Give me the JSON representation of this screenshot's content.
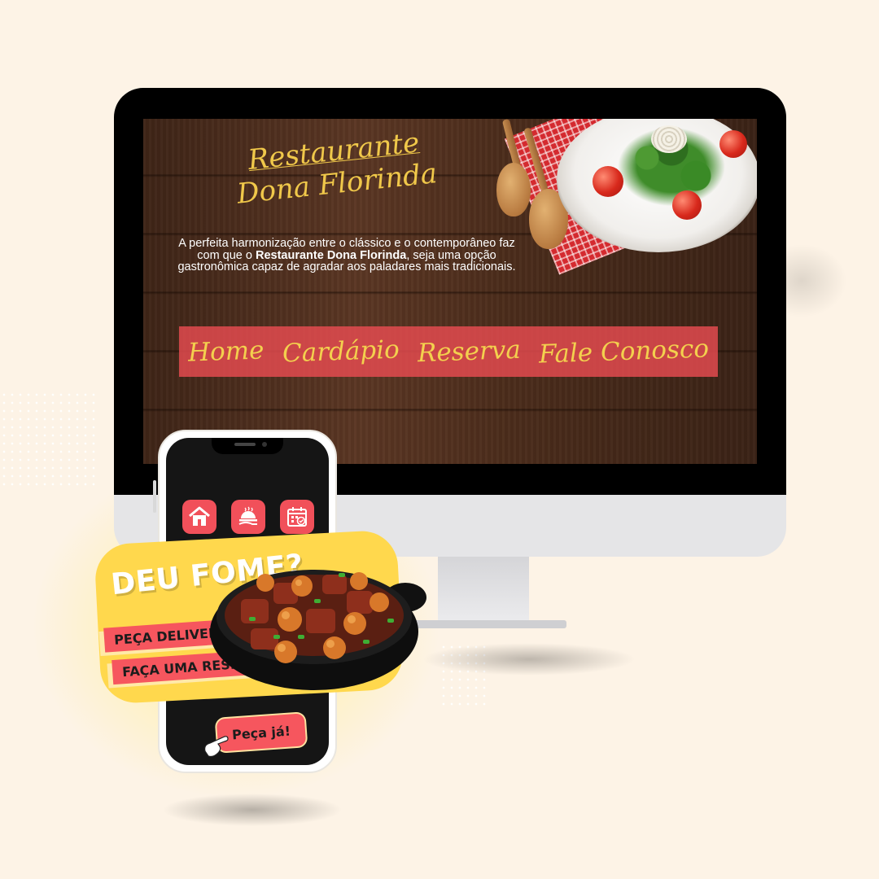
{
  "website": {
    "title_line1": "Restaurante",
    "title_line2": "Dona Florinda",
    "description_prefix": "A perfeita harmonização entre o clássico e o contemporâneo faz com que o ",
    "description_bold": "Restaurante Dona Florinda",
    "description_suffix": ", seja uma opção gastronômica capaz de agradar aos paladares mais tradicionais.",
    "nav": [
      "Home",
      "Cardápio",
      "Reserva",
      "Fale Conosco"
    ]
  },
  "mobile": {
    "apps": [
      {
        "icon": "home-icon"
      },
      {
        "icon": "delivery-tray-icon"
      },
      {
        "icon": "calendar-icon"
      }
    ],
    "promo_title": "DEU FOME?",
    "delivery_label": "PEÇA DELIVERY",
    "reserve_label": "FAÇA UMA RESERVA",
    "cta_label": "Peça já!"
  },
  "colors": {
    "background": "#fdf3e6",
    "accent_red": "#f6565e",
    "accent_yellow": "#ffd84d",
    "title_gold": "#f0c84a"
  }
}
